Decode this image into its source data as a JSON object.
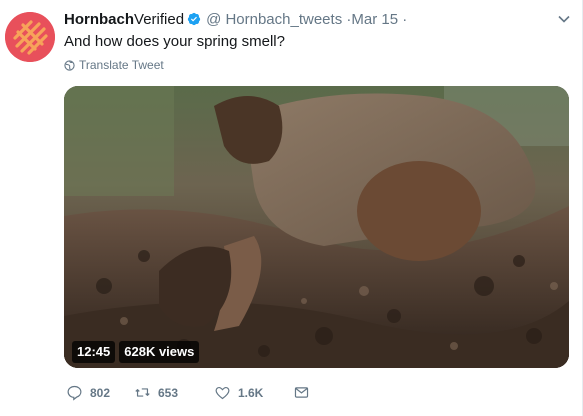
{
  "tweet": {
    "author_name": "Hornbach",
    "verified_label": "Verified",
    "handle": "@ Hornbach_tweets",
    "separator": "·",
    "time": "Mar 15",
    "trailing_separator": "·",
    "text": "And how does your spring smell?",
    "translate_label": "Translate Tweet"
  },
  "video": {
    "duration": "12:45",
    "views": "628K views"
  },
  "actions": {
    "replies": "802",
    "retweets": "653",
    "likes": "1.6K"
  },
  "icons": {
    "avatar": "hornbach-logo",
    "verified": "verified-badge-icon",
    "caret": "chevron-down-icon",
    "globe": "globe-icon",
    "reply": "reply-icon",
    "retweet": "retweet-icon",
    "like": "heart-icon",
    "dm": "envelope-icon"
  },
  "colors": {
    "brand": "#e8505b",
    "verified_blue": "#1da1f2",
    "secondary_text": "#657786"
  }
}
